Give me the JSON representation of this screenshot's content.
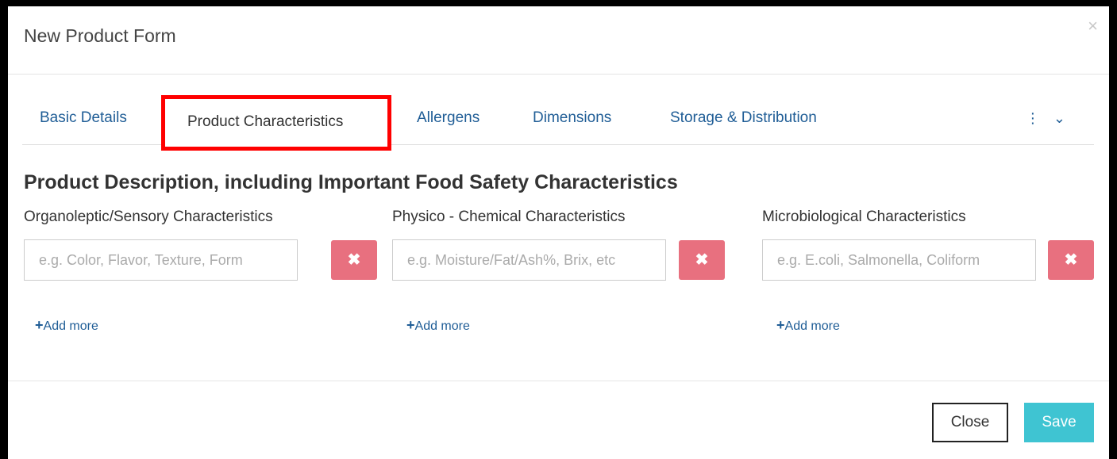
{
  "modal": {
    "title": "New Product Form",
    "close_icon": "×"
  },
  "tabs": [
    {
      "label": "Basic Details"
    },
    {
      "label": "Product Characteristics"
    },
    {
      "label": "Allergens"
    },
    {
      "label": "Dimensions"
    },
    {
      "label": "Storage & Distribution"
    }
  ],
  "tabs_more_icon": "⋮ ⌄",
  "section": {
    "title": "Product Description, including Important Food Safety Characteristics"
  },
  "columns": [
    {
      "label": "Organoleptic/Sensory Characteristics",
      "placeholder": "e.g. Color, Flavor, Texture, Form",
      "value": "",
      "add_more": "Add more"
    },
    {
      "label": "Physico - Chemical Characteristics",
      "placeholder": "e.g. Moisture/Fat/Ash%, Brix, etc",
      "value": "",
      "add_more": "Add more"
    },
    {
      "label": "Microbiological Characteristics",
      "placeholder": "e.g. E.coli, Salmonella, Coliform",
      "value": "",
      "add_more": "Add more"
    }
  ],
  "delete_icon": "✖",
  "add_icon": "+",
  "footer": {
    "close_label": "Close",
    "save_label": "Save"
  },
  "colors": {
    "accent_link": "#1f5d96",
    "delete_button": "#e8707f",
    "save_button": "#3fc4d2",
    "highlight_border": "#ff0000"
  }
}
